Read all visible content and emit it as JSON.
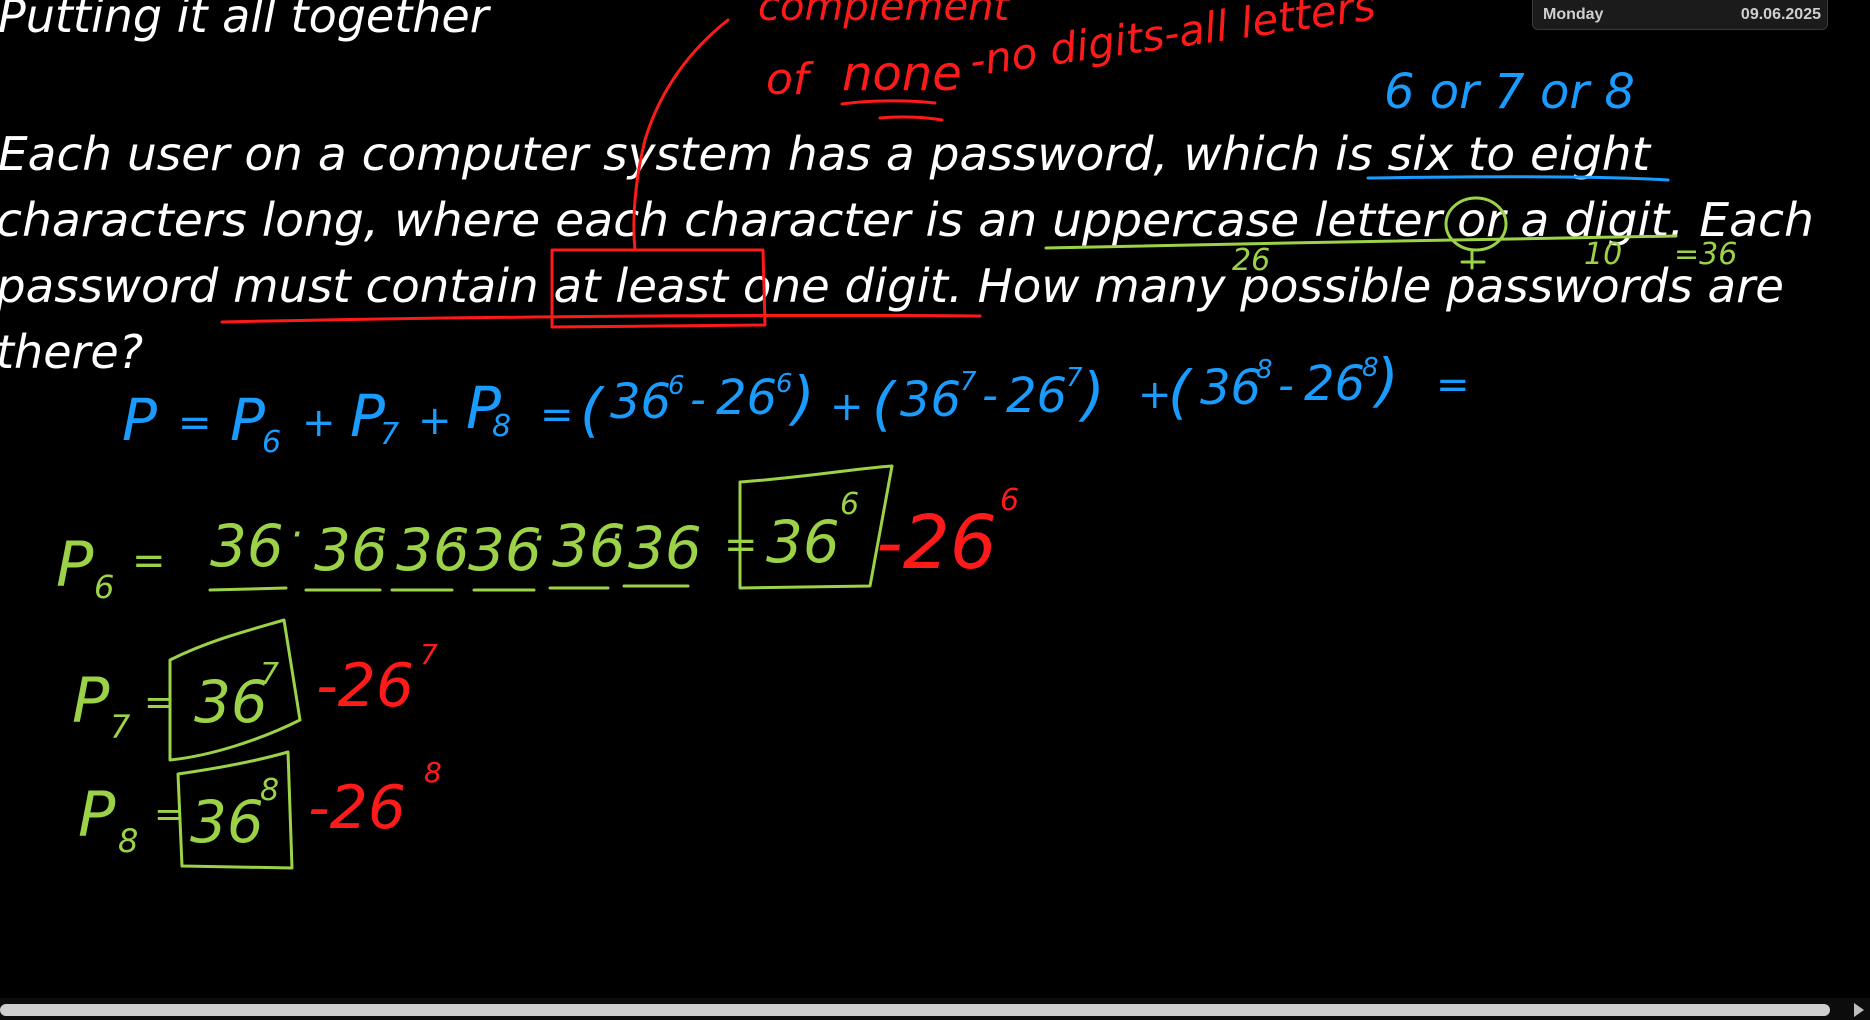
{
  "colors": {
    "background": "#000000",
    "text": "#ffffff",
    "red_ink": "#ff1a1a",
    "blue_ink": "#1a9cff",
    "green_ink": "#9cd247"
  },
  "widget": {
    "day": "Monday",
    "date": "09.06.2025"
  },
  "slide": {
    "heading": "Putting it all together",
    "problem_lines": [
      "Each user on a computer system has a password, which is six to eight",
      "characters long, where each character is an uppercase letter or a digit. Each",
      "password must contain at least one digit. How many possible passwords are",
      "there?"
    ]
  },
  "annotations": {
    "red_note_line1": "complement",
    "red_note_line2_a": "of",
    "red_note_line2_b": "none",
    "red_note_line2_c": "-no digits-all letters",
    "blue_lengths": "6 or 7 or 8",
    "num_letters": "26",
    "num_digits": "10",
    "total_chars": "=36"
  },
  "formula": {
    "lhs": "P",
    "eq": "=",
    "p6": "P",
    "sub6": "6",
    "plus": "+",
    "p7": "P",
    "sub7": "7",
    "p8": "P",
    "sub8": "8",
    "eq2": "=",
    "open": "(",
    "close": ")",
    "b36": "36",
    "b26": "26",
    "minus": "-",
    "e6": "6",
    "e7": "7",
    "e8": "8",
    "tail": "="
  },
  "derivation": {
    "p6_label": "P",
    "p6_sub": "6",
    "p6_eq": "=",
    "slot": "36",
    "dot": "·",
    "eq": "=",
    "boxed_base": "36",
    "exp6": "6",
    "exp7": "7",
    "exp8": "8",
    "red_part": "-26",
    "p7_label": "P",
    "p7_sub": "7",
    "p8_label": "P",
    "p8_sub": "8"
  }
}
